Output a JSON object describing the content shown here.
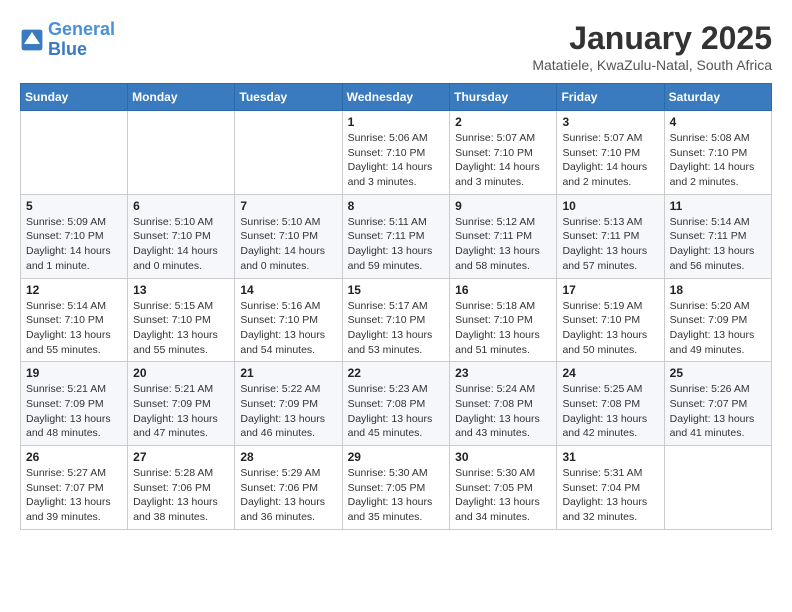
{
  "header": {
    "logo_line1": "General",
    "logo_line2": "Blue",
    "month": "January 2025",
    "location": "Matatiele, KwaZulu-Natal, South Africa"
  },
  "weekdays": [
    "Sunday",
    "Monday",
    "Tuesday",
    "Wednesday",
    "Thursday",
    "Friday",
    "Saturday"
  ],
  "weeks": [
    [
      {
        "day": "",
        "info": ""
      },
      {
        "day": "",
        "info": ""
      },
      {
        "day": "",
        "info": ""
      },
      {
        "day": "1",
        "info": "Sunrise: 5:06 AM\nSunset: 7:10 PM\nDaylight: 14 hours and 3 minutes."
      },
      {
        "day": "2",
        "info": "Sunrise: 5:07 AM\nSunset: 7:10 PM\nDaylight: 14 hours and 3 minutes."
      },
      {
        "day": "3",
        "info": "Sunrise: 5:07 AM\nSunset: 7:10 PM\nDaylight: 14 hours and 2 minutes."
      },
      {
        "day": "4",
        "info": "Sunrise: 5:08 AM\nSunset: 7:10 PM\nDaylight: 14 hours and 2 minutes."
      }
    ],
    [
      {
        "day": "5",
        "info": "Sunrise: 5:09 AM\nSunset: 7:10 PM\nDaylight: 14 hours and 1 minute."
      },
      {
        "day": "6",
        "info": "Sunrise: 5:10 AM\nSunset: 7:10 PM\nDaylight: 14 hours and 0 minutes."
      },
      {
        "day": "7",
        "info": "Sunrise: 5:10 AM\nSunset: 7:10 PM\nDaylight: 14 hours and 0 minutes."
      },
      {
        "day": "8",
        "info": "Sunrise: 5:11 AM\nSunset: 7:11 PM\nDaylight: 13 hours and 59 minutes."
      },
      {
        "day": "9",
        "info": "Sunrise: 5:12 AM\nSunset: 7:11 PM\nDaylight: 13 hours and 58 minutes."
      },
      {
        "day": "10",
        "info": "Sunrise: 5:13 AM\nSunset: 7:11 PM\nDaylight: 13 hours and 57 minutes."
      },
      {
        "day": "11",
        "info": "Sunrise: 5:14 AM\nSunset: 7:11 PM\nDaylight: 13 hours and 56 minutes."
      }
    ],
    [
      {
        "day": "12",
        "info": "Sunrise: 5:14 AM\nSunset: 7:10 PM\nDaylight: 13 hours and 55 minutes."
      },
      {
        "day": "13",
        "info": "Sunrise: 5:15 AM\nSunset: 7:10 PM\nDaylight: 13 hours and 55 minutes."
      },
      {
        "day": "14",
        "info": "Sunrise: 5:16 AM\nSunset: 7:10 PM\nDaylight: 13 hours and 54 minutes."
      },
      {
        "day": "15",
        "info": "Sunrise: 5:17 AM\nSunset: 7:10 PM\nDaylight: 13 hours and 53 minutes."
      },
      {
        "day": "16",
        "info": "Sunrise: 5:18 AM\nSunset: 7:10 PM\nDaylight: 13 hours and 51 minutes."
      },
      {
        "day": "17",
        "info": "Sunrise: 5:19 AM\nSunset: 7:10 PM\nDaylight: 13 hours and 50 minutes."
      },
      {
        "day": "18",
        "info": "Sunrise: 5:20 AM\nSunset: 7:09 PM\nDaylight: 13 hours and 49 minutes."
      }
    ],
    [
      {
        "day": "19",
        "info": "Sunrise: 5:21 AM\nSunset: 7:09 PM\nDaylight: 13 hours and 48 minutes."
      },
      {
        "day": "20",
        "info": "Sunrise: 5:21 AM\nSunset: 7:09 PM\nDaylight: 13 hours and 47 minutes."
      },
      {
        "day": "21",
        "info": "Sunrise: 5:22 AM\nSunset: 7:09 PM\nDaylight: 13 hours and 46 minutes."
      },
      {
        "day": "22",
        "info": "Sunrise: 5:23 AM\nSunset: 7:08 PM\nDaylight: 13 hours and 45 minutes."
      },
      {
        "day": "23",
        "info": "Sunrise: 5:24 AM\nSunset: 7:08 PM\nDaylight: 13 hours and 43 minutes."
      },
      {
        "day": "24",
        "info": "Sunrise: 5:25 AM\nSunset: 7:08 PM\nDaylight: 13 hours and 42 minutes."
      },
      {
        "day": "25",
        "info": "Sunrise: 5:26 AM\nSunset: 7:07 PM\nDaylight: 13 hours and 41 minutes."
      }
    ],
    [
      {
        "day": "26",
        "info": "Sunrise: 5:27 AM\nSunset: 7:07 PM\nDaylight: 13 hours and 39 minutes."
      },
      {
        "day": "27",
        "info": "Sunrise: 5:28 AM\nSunset: 7:06 PM\nDaylight: 13 hours and 38 minutes."
      },
      {
        "day": "28",
        "info": "Sunrise: 5:29 AM\nSunset: 7:06 PM\nDaylight: 13 hours and 36 minutes."
      },
      {
        "day": "29",
        "info": "Sunrise: 5:30 AM\nSunset: 7:05 PM\nDaylight: 13 hours and 35 minutes."
      },
      {
        "day": "30",
        "info": "Sunrise: 5:30 AM\nSunset: 7:05 PM\nDaylight: 13 hours and 34 minutes."
      },
      {
        "day": "31",
        "info": "Sunrise: 5:31 AM\nSunset: 7:04 PM\nDaylight: 13 hours and 32 minutes."
      },
      {
        "day": "",
        "info": ""
      }
    ]
  ]
}
